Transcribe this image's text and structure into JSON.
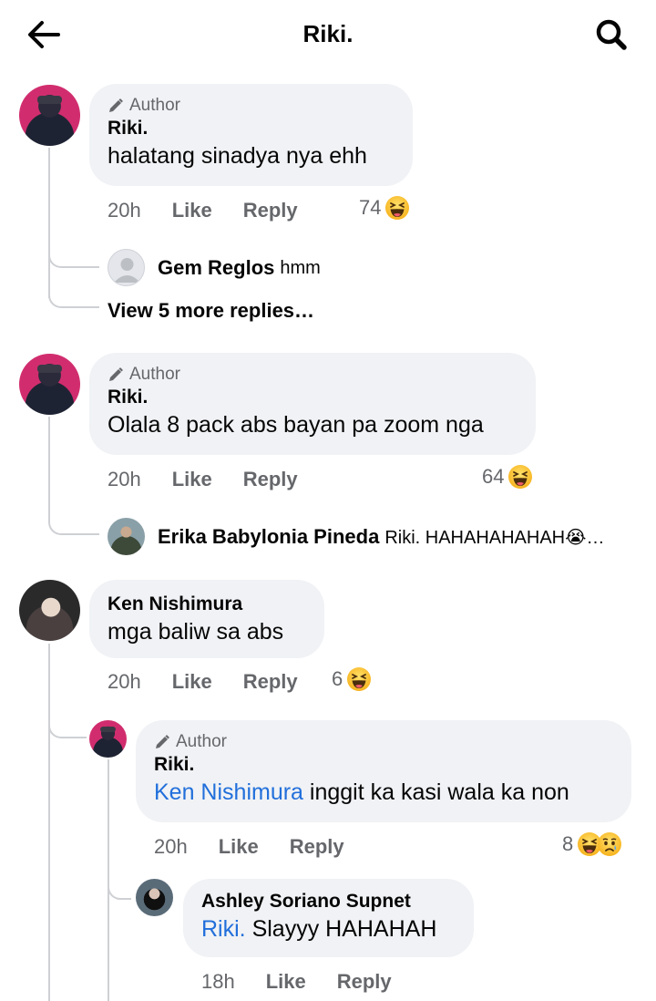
{
  "header": {
    "title": "Riki.",
    "back_icon": "arrow-left-icon",
    "search_icon": "search-icon"
  },
  "colors": {
    "bubble_bg": "#f0f2f5",
    "mention": "#216fdb",
    "secondary_text": "#65676b",
    "thread_line": "#ced0d4"
  },
  "comments": [
    {
      "author_badge": "Author",
      "name": "Riki.",
      "text": "halatang sinadya nya ehh",
      "time": "20h",
      "like": "Like",
      "reply": "Reply",
      "reaction_count": "74",
      "reactions": [
        "haha"
      ],
      "reply_preview": {
        "name": "Gem Reglos",
        "text": "hmm"
      },
      "view_more": "View 5 more replies…"
    },
    {
      "author_badge": "Author",
      "name": "Riki.",
      "text": "Olala 8 pack abs bayan pa zoom nga",
      "time": "20h",
      "like": "Like",
      "reply": "Reply",
      "reaction_count": "64",
      "reactions": [
        "haha"
      ],
      "reply_preview": {
        "name": "Erika Babylonia Pineda",
        "text": "Riki. HAHAHAHAHAH😭…"
      }
    },
    {
      "name": "Ken Nishimura",
      "text": "mga baliw sa abs",
      "time": "20h",
      "like": "Like",
      "reply": "Reply",
      "reaction_count": "6",
      "reactions": [
        "haha"
      ],
      "replies": [
        {
          "author_badge": "Author",
          "name": "Riki.",
          "mention": "Ken Nishimura",
          "text": "inggit ka kasi wala ka non",
          "time": "20h",
          "like": "Like",
          "reply": "Reply",
          "reaction_count": "8",
          "reactions": [
            "haha",
            "sad"
          ]
        },
        {
          "name": "Ashley Soriano Supnet",
          "mention": "Riki.",
          "text": "Slayyy HAHAHAH",
          "time": "18h",
          "like": "Like",
          "reply": "Reply"
        }
      ]
    }
  ]
}
